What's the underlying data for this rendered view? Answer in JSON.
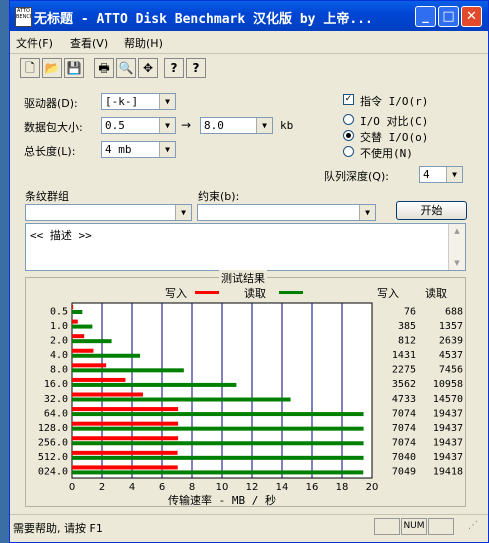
{
  "window": {
    "title": "无标题 - ATTO Disk Benchmark  汉化版 by 上帝...",
    "icon_text": "ATTO BENCH",
    "min": "_",
    "max": "□",
    "close": "✕"
  },
  "menu": [
    "文件(F)",
    "查看(V)",
    "帮助(H)"
  ],
  "toolbar": {
    "icons": [
      "new-document-icon",
      "open-folder-icon",
      "save-icon",
      "print-icon",
      "print-preview-icon",
      "move-icon",
      "help-icon",
      "context-help-icon"
    ],
    "glyphs": [
      "🗋",
      "📂",
      "💾",
      "🖶",
      "🔍",
      "✥",
      "?",
      "?"
    ]
  },
  "form": {
    "drive_label": "驱动器(D):",
    "drive_value": "[-k-]",
    "transfer_label": "数据包大小:",
    "transfer_from": "0.5",
    "transfer_arrow": "→",
    "transfer_to": "8.0",
    "transfer_unit": "kb",
    "total_label": "总长度(L):",
    "total_value": "4 mb",
    "direct_io_label": "指令 I/O(r)",
    "direct_io_checked": "✓",
    "io_compare_label": "I/O 对比(C)",
    "overlapped_label": "交替 I/O(o)",
    "neither_label": "不使用(N)",
    "queue_label": "队列深度(Q):",
    "queue_value": "4",
    "stripe_label": "条纹群组",
    "stripe_value": "",
    "constraint_label": "约束(b):",
    "constraint_value": "",
    "start_button": "开始",
    "description": "<< 描述 >>"
  },
  "results": {
    "group_title": "测试结果",
    "legend_write": "写入",
    "legend_read": "读取",
    "write_header": "写入",
    "read_header": "读取",
    "x_axis_label": "传输速率 - MB / 秒"
  },
  "chart_data": {
    "type": "bar",
    "orientation": "horizontal",
    "categories": [
      "0.5",
      "1.0",
      "2.0",
      "4.0",
      "8.0",
      "16.0",
      "32.0",
      "64.0",
      "128.0",
      "256.0",
      "512.0",
      "024.0"
    ],
    "series": [
      {
        "name": "写入",
        "color": "#ff0000",
        "values": [
          0.076,
          0.385,
          0.812,
          1.431,
          2.275,
          3.562,
          4.733,
          7.074,
          7.074,
          7.074,
          7.04,
          7.049
        ]
      },
      {
        "name": "读取",
        "color": "#008000",
        "values": [
          0.688,
          1.357,
          2.639,
          4.537,
          7.456,
          10.958,
          14.57,
          19.437,
          19.437,
          19.437,
          19.437,
          19.418
        ]
      }
    ],
    "write_values_text": [
      "76",
      "385",
      "812",
      "1431",
      "2275",
      "3562",
      "4733",
      "7074",
      "7074",
      "7074",
      "7040",
      "7049"
    ],
    "read_values_text": [
      "688",
      "1357",
      "2639",
      "4537",
      "7456",
      "10958",
      "14570",
      "19437",
      "19437",
      "19437",
      "19437",
      "19418"
    ],
    "xticks": [
      "0",
      "2",
      "4",
      "6",
      "8",
      "10",
      "12",
      "14",
      "16",
      "18",
      "20"
    ],
    "xlim": [
      0,
      20
    ],
    "xlabel": "传输速率 - MB / 秒",
    "grid": true,
    "legend": "top"
  },
  "status": {
    "text": "需要帮助, 请按 F1",
    "num": "NUM"
  }
}
